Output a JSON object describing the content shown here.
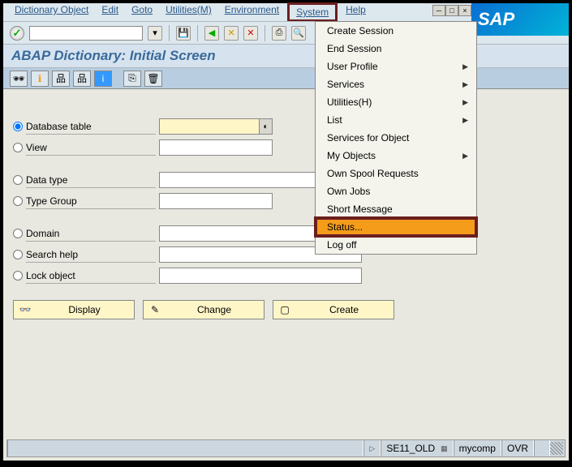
{
  "menubar": {
    "items": [
      "Dictionary Object",
      "Edit",
      "Goto",
      "Utilities(M)",
      "Environment",
      "System",
      "Help"
    ],
    "highlighted_index": 5
  },
  "logo": "SAP",
  "title": "ABAP Dictionary: Initial Screen",
  "radios": {
    "database_table": "Database table",
    "view": "View",
    "data_type": "Data type",
    "type_group": "Type Group",
    "domain": "Domain",
    "search_help": "Search help",
    "lock_object": "Lock object"
  },
  "selected_radio": "database_table",
  "actions": {
    "display": "Display",
    "change": "Change",
    "create": "Create"
  },
  "dropdown": {
    "items": [
      {
        "label": "Create Session",
        "arrow": false
      },
      {
        "label": "End Session",
        "arrow": false
      },
      {
        "label": "User Profile",
        "arrow": true
      },
      {
        "label": "Services",
        "arrow": true
      },
      {
        "label": "Utilities(H)",
        "arrow": true
      },
      {
        "label": "List",
        "arrow": true
      },
      {
        "label": "Services for Object",
        "arrow": false
      },
      {
        "label": "My Objects",
        "arrow": true
      },
      {
        "label": "Own Spool Requests",
        "arrow": false
      },
      {
        "label": "Own Jobs",
        "arrow": false
      },
      {
        "label": "Short Message",
        "arrow": false
      },
      {
        "label": "Status...",
        "arrow": false
      },
      {
        "label": "Log off",
        "arrow": false
      }
    ],
    "selected_index": 11
  },
  "statusbar": {
    "tcode": "SE11_OLD",
    "system": "mycomp",
    "mode": "OVR"
  }
}
